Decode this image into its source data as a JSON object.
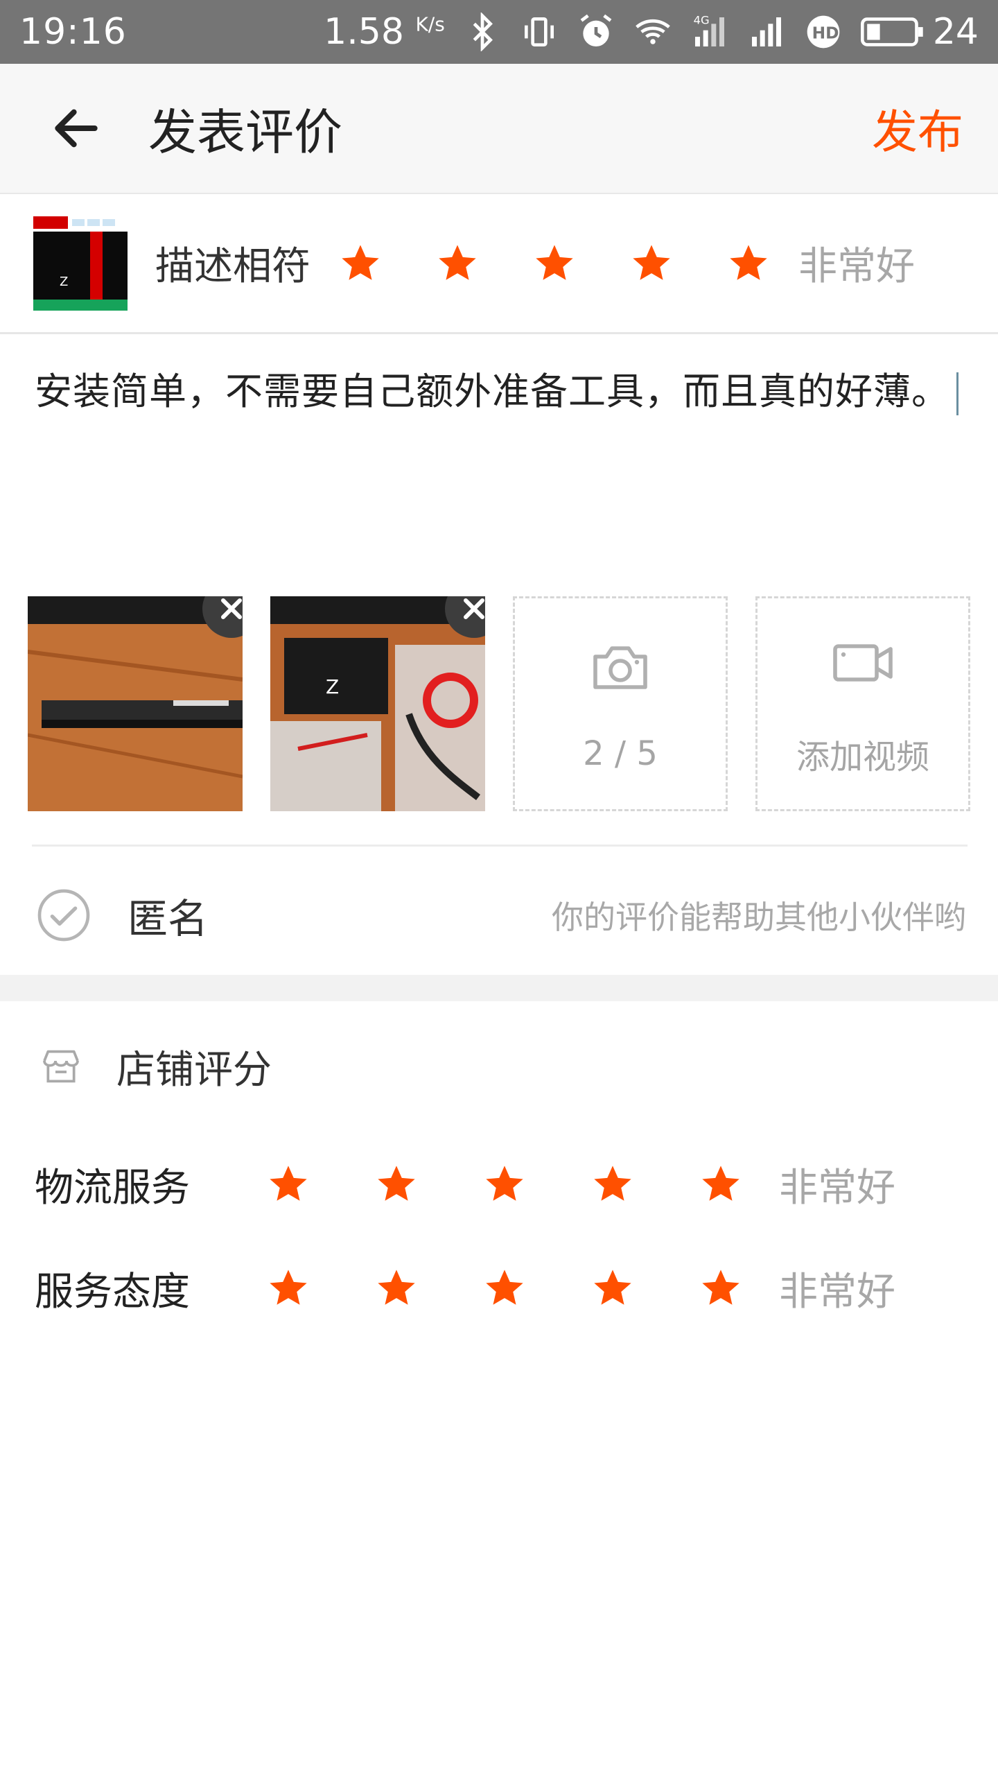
{
  "status_bar": {
    "time": "19:16",
    "net_speed": "1.58",
    "net_unit": "K/s",
    "network_type": "4G",
    "battery_level": "24",
    "icons": [
      "bluetooth-icon",
      "vibrate-icon",
      "alarm-icon",
      "wifi-icon",
      "signal-4g-icon",
      "signal-icon",
      "hd-icon",
      "battery-icon"
    ]
  },
  "header": {
    "title": "发表评价",
    "publish_label": "发布"
  },
  "product_rating": {
    "label": "描述相符",
    "stars": 5,
    "rating_text": "非常好"
  },
  "review": {
    "text": "安装简单，不需要自己额外准备工具，而且真的好薄。"
  },
  "media": {
    "photo_count_label": "2 / 5",
    "add_video_label": "添加视频",
    "photos": [
      "photo-1",
      "photo-2"
    ]
  },
  "anonymous": {
    "label": "匿名",
    "hint": "你的评价能帮助其他小伙伴哟"
  },
  "shop_rating": {
    "title": "店铺评分",
    "rows": [
      {
        "label": "物流服务",
        "stars": 5,
        "rating_text": "非常好"
      },
      {
        "label": "服务态度",
        "stars": 5,
        "rating_text": "非常好"
      }
    ]
  },
  "colors": {
    "accent": "#ff5000",
    "status_bar": "#757575",
    "muted_text": "#a8a8a8"
  }
}
